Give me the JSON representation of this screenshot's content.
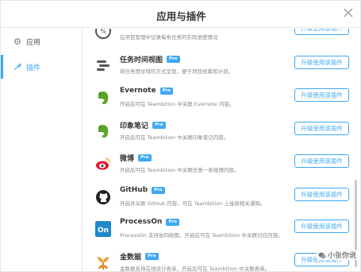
{
  "dialog": {
    "title": "应用与插件"
  },
  "sidebar": {
    "items": [
      {
        "label": "应用",
        "icon": "gear-icon"
      },
      {
        "label": "插件",
        "icon": "wrench-icon"
      }
    ]
  },
  "plugins": [
    {
      "name": "",
      "desc": "在项目管理中记录每条任务的实际进度情况",
      "button": "升级使用该插件",
      "icon": "progress-icon",
      "pro": false
    },
    {
      "name": "任务时间视图",
      "badge": "Pro",
      "desc": "将任务用甘特的方式呈现，便于项目统筹和计划。",
      "button": "升级使用该插件",
      "icon": "timeline-icon"
    },
    {
      "name": "Evernote",
      "badge": "Pro",
      "desc": "开启后可在 Teambition 中关联 Evernote 内容。",
      "button": "升级使用该插件",
      "icon": "evernote-icon"
    },
    {
      "name": "印象笔记",
      "badge": "Pro",
      "desc": "开启后可在 Teambition 中关联印象笔记内容。",
      "button": "升级使用该插件",
      "icon": "yinxiang-icon"
    },
    {
      "name": "微博",
      "badge": "Pro",
      "desc": "开启后可在 Teambition 中关联任意一条微博内容。",
      "button": "升级使用该插件",
      "icon": "weibo-icon"
    },
    {
      "name": "GitHub",
      "badge": "Pro",
      "desc": "开启并关联 GitHub 内容，可在 Teambition 上接收相关通知。",
      "button": "升级使用该插件",
      "icon": "github-icon"
    },
    {
      "name": "ProcessOn",
      "badge": "Pro",
      "desc": "ProcessOn 支持协同绘图，开启后可在 Teambition 中关联对应内容。",
      "button": "升级使用该插件",
      "icon": "processon-icon"
    },
    {
      "name": "金数据",
      "badge": "Pro",
      "desc": "金数据支持在线设计表单，开启后可在 Teambition 中关联表单。",
      "button": "升级使用该插件",
      "icon": "jinshuju-icon"
    }
  ],
  "watermark": "小张你说"
}
